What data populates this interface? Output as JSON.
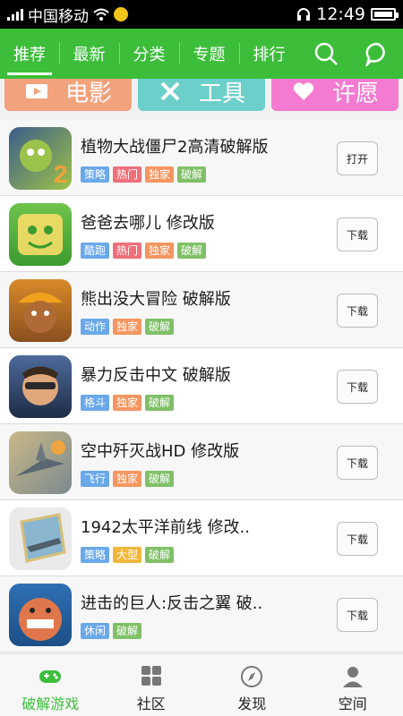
{
  "status_bar": {
    "carrier": "中国移动",
    "time": "12:49"
  },
  "top_nav": {
    "tabs": [
      "推荐",
      "最新",
      "分类",
      "专题",
      "排行"
    ],
    "active_index": 0,
    "search_icon": "search-icon",
    "chat_icon": "chat-bubble-icon"
  },
  "categories": [
    {
      "label": "电影",
      "icon": "film-icon",
      "color": "#f2a27d"
    },
    {
      "label": "工具",
      "icon": "tools-icon",
      "color": "#6ccfc9"
    },
    {
      "label": "许愿",
      "icon": "heart-icon",
      "color": "#f57ad1"
    }
  ],
  "apps": [
    {
      "title": "植物大战僵尸2高清破解版",
      "tags": [
        "策略",
        "热门",
        "独家",
        "破解"
      ],
      "button": "打开"
    },
    {
      "title": "爸爸去哪儿 修改版",
      "tags": [
        "酷跑",
        "热门",
        "独家",
        "破解"
      ],
      "button": "下载"
    },
    {
      "title": "熊出没大冒险 破解版",
      "tags": [
        "动作",
        "独家",
        "破解"
      ],
      "button": "下载"
    },
    {
      "title": "暴力反击中文 破解版",
      "tags": [
        "格斗",
        "独家",
        "破解"
      ],
      "button": "下载"
    },
    {
      "title": "空中歼灭战HD 修改版",
      "tags": [
        "飞行",
        "独家",
        "破解"
      ],
      "button": "下载"
    },
    {
      "title": "1942太平洋前线 修改..",
      "tags": [
        "策略",
        "大型",
        "破解"
      ],
      "button": "下载"
    },
    {
      "title": "进击的巨人:反击之翼 破..",
      "tags": [
        "休闲",
        "破解"
      ],
      "button": "下载"
    }
  ],
  "tag_colors": {
    "策略": "#6aa8ea",
    "热门": "#ef6f7a",
    "独家": "#f5955f",
    "破解": "#7fc066",
    "酷跑": "#6aa8ea",
    "动作": "#6aa8ea",
    "格斗": "#6aa8ea",
    "飞行": "#6aa8ea",
    "大型": "#f0b73b",
    "休闲": "#6aa8ea"
  },
  "bottom_nav": [
    {
      "label": "破解游戏",
      "icon": "gamepad-icon",
      "active": true
    },
    {
      "label": "社区",
      "icon": "grid-icon",
      "active": false
    },
    {
      "label": "发现",
      "icon": "compass-icon",
      "active": false
    },
    {
      "label": "空间",
      "icon": "user-icon",
      "active": false
    }
  ],
  "colors": {
    "brand_green": "#3dbe3b"
  }
}
